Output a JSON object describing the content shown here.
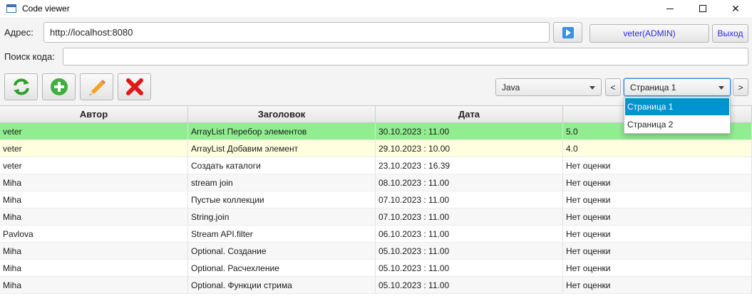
{
  "window": {
    "title": "Code viewer"
  },
  "address": {
    "label": "Адрес:",
    "value": "http://localhost:8080"
  },
  "user": {
    "label": "veter(ADMIN)",
    "logout": "Выход"
  },
  "search": {
    "label": "Поиск кода:",
    "value": "",
    "placeholder": ""
  },
  "toolbar": {
    "icons": [
      "refresh-icon",
      "add-icon",
      "edit-icon",
      "delete-icon"
    ]
  },
  "language": {
    "selected": "Java"
  },
  "pager": {
    "prev": "<",
    "next": ">",
    "selected": "Страница 1",
    "options": [
      "Страница 1",
      "Страница 2"
    ]
  },
  "table": {
    "columns": [
      "Автор",
      "Заголовок",
      "Дата",
      ""
    ],
    "rows": [
      [
        "veter",
        "ArrayList Перебор элементов",
        "30.10.2023 : 11.00",
        "5.0"
      ],
      [
        "veter",
        "ArrayList Добавим элемент",
        "29.10.2023 : 10.00",
        "4.0"
      ],
      [
        "veter",
        "Создать каталоги",
        "23.10.2023 : 16.39",
        "Нет оценки"
      ],
      [
        "Miha",
        "stream join",
        "08.10.2023 : 11.00",
        "Нет оценки"
      ],
      [
        "Miha",
        "Пустые коллекции",
        "07.10.2023 : 11.00",
        "Нет оценки"
      ],
      [
        "Miha",
        "String.join",
        "07.10.2023 : 11.00",
        "Нет оценки"
      ],
      [
        "Pavlova",
        "Stream API.filter",
        "06.10.2023 : 11.00",
        "Нет оценки"
      ],
      [
        "Miha",
        "Optional. Создание",
        "05.10.2023 : 11.00",
        "Нет оценки"
      ],
      [
        "Miha",
        "Optional. Расчехление",
        "05.10.2023 : 11.00",
        "Нет оценки"
      ],
      [
        "Miha",
        "Optional. Функции стрима",
        "05.10.2023 : 11.00",
        "Нет оценки"
      ]
    ],
    "row_colors": [
      "#90ee90",
      "#ffffe0",
      "#ffffff",
      "#f7f7f7",
      "#ffffff",
      "#f7f7f7",
      "#ffffff",
      "#f7f7f7",
      "#ffffff",
      "#f7f7f7"
    ]
  },
  "colors": {
    "accent": "#0093d1",
    "link": "#2b2bd6"
  }
}
